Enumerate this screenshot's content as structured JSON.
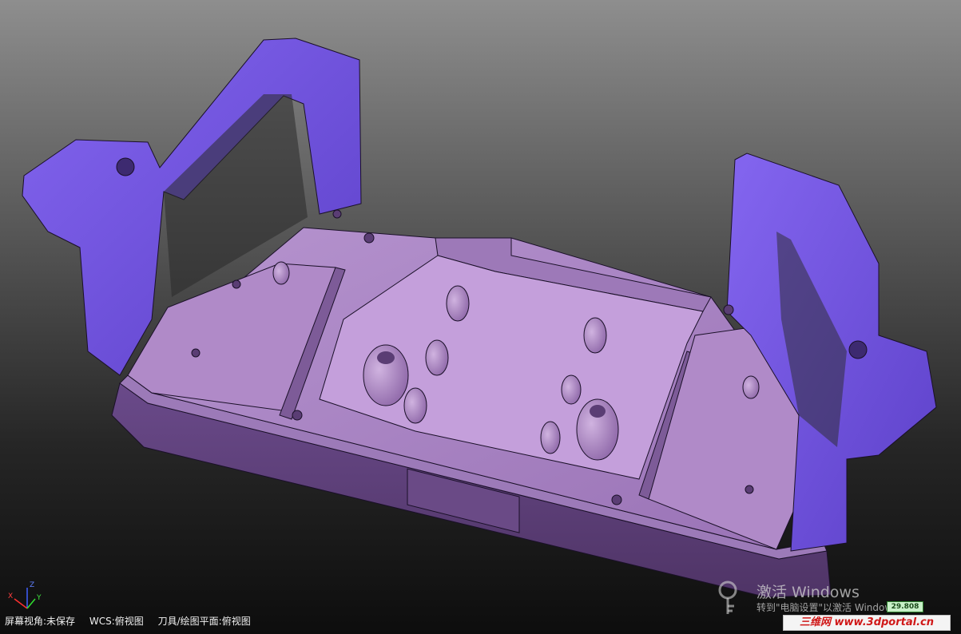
{
  "viewport": {
    "background_top": "#8e8e8e",
    "background_bottom": "#0d0d0d",
    "model_color_dark": "#7055e6",
    "model_color_light": "#b791cf"
  },
  "axis": {
    "x_label": "X",
    "y_label": "Y",
    "z_label": "Z"
  },
  "status_bar": {
    "view_status": "屏幕视角:未保存",
    "wcs": "WCS:俯视图",
    "tool_plane": "刀具/绘图平面:俯视图"
  },
  "activation_watermark": {
    "title": "激活 Windows",
    "subtitle": "转到\"电脑设置\"以激活 Windows。"
  },
  "scale_value": "29.808",
  "site_logo_text": "三维网 www.3dportal.cn"
}
